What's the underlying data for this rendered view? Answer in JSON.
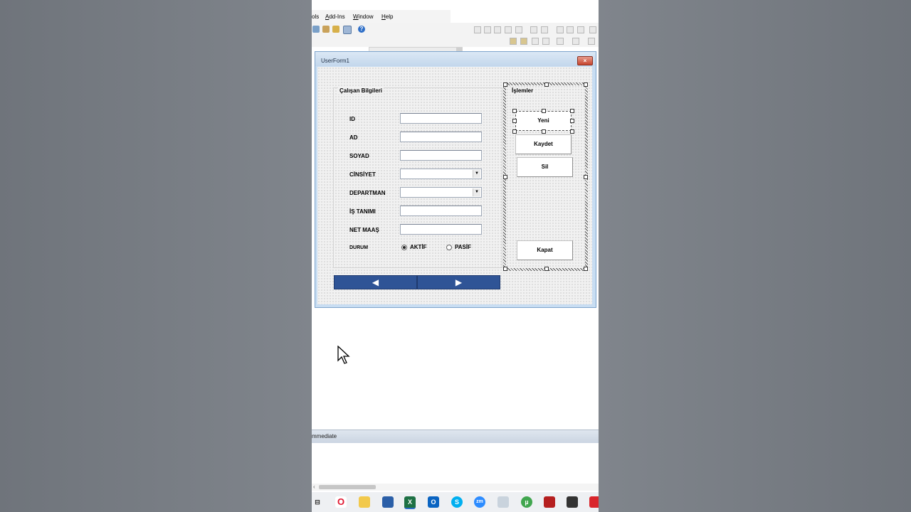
{
  "menu": {
    "items": [
      {
        "label": "ols",
        "ul": ""
      },
      {
        "label": "dd-Ins",
        "ul": "A"
      },
      {
        "label": "indow",
        "ul": "W"
      },
      {
        "label": "elp",
        "ul": "H"
      }
    ]
  },
  "help_icon": "?",
  "userform": {
    "title": "UserForm1",
    "close_icon": "×",
    "frame_info": {
      "label": "Çalışan Bilgileri",
      "fields": [
        {
          "label": "ID",
          "kind": "text"
        },
        {
          "label": "AD",
          "kind": "text"
        },
        {
          "label": "SOYAD",
          "kind": "text"
        },
        {
          "label": "CİNSİYET",
          "kind": "combo"
        },
        {
          "label": "DEPARTMAN",
          "kind": "combo"
        },
        {
          "label": "İŞ TANIMI",
          "kind": "text"
        },
        {
          "label": "NET MAAŞ",
          "kind": "text"
        }
      ],
      "durum": {
        "label": "DURUM",
        "options": [
          {
            "label": "AKTİF",
            "selected": true
          },
          {
            "label": "PASİF",
            "selected": false
          }
        ]
      }
    },
    "frame_ops": {
      "label": "İşlemler",
      "buttons": [
        "Yeni",
        "Kaydet",
        "Sil",
        "Kapat"
      ]
    },
    "nav": {
      "prev_icon": "◀",
      "next_icon": "▶"
    }
  },
  "immediate": {
    "label": "mmediate"
  },
  "taskbar": {
    "icons": [
      "task-view-icon",
      "opera-icon",
      "file-explorer-icon",
      "store-icon",
      "excel-icon",
      "outlook-icon",
      "skype-icon",
      "zoom-icon",
      "tool-icon",
      "utorrent-icon",
      "app-icon",
      "video-app-icon",
      "app-red-icon"
    ]
  },
  "colors": {
    "nav_button": "#2f5496",
    "form_border": "#7ea4cc",
    "close_red": "#c6452e"
  }
}
